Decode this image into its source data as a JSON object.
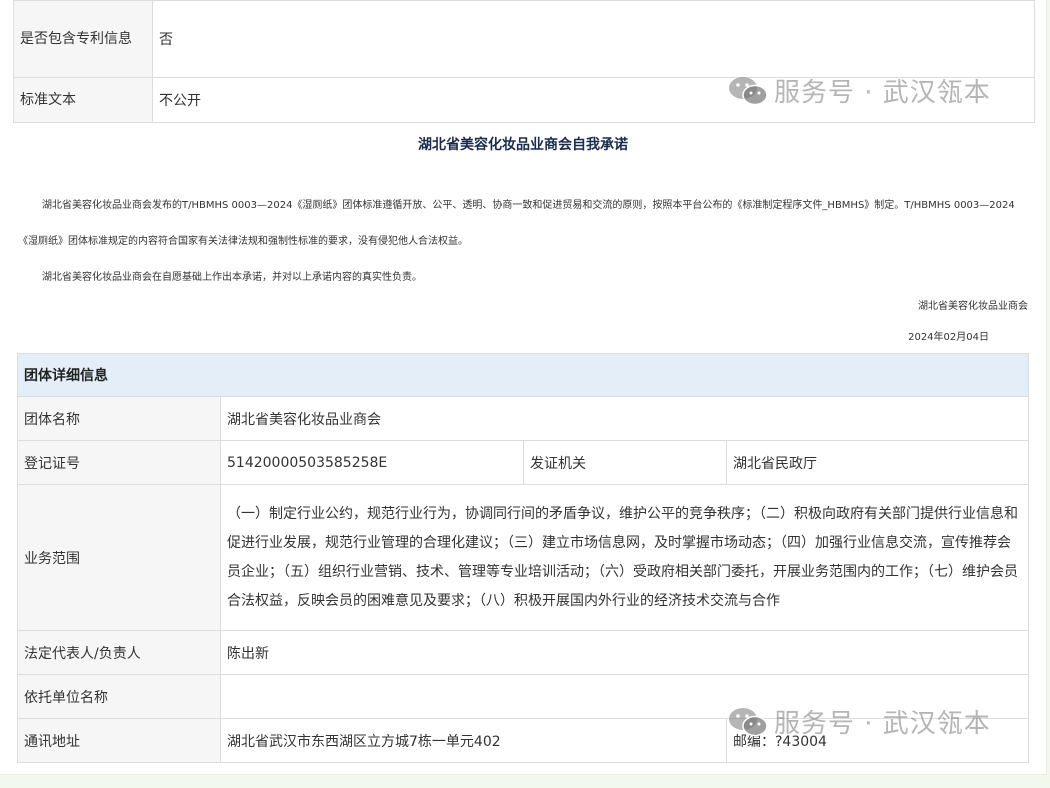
{
  "top_table": {
    "rows": [
      {
        "label": "是否包含专利信息",
        "value": "否"
      },
      {
        "label": "标准文本",
        "value": "不公开"
      }
    ]
  },
  "commitment": {
    "title": "湖北省美容化妆品业商会自我承诺",
    "paragraph1": "湖北省美容化妆品业商会发布的T/HBMHS 0003—2024《湿厕纸》团体标准遵循开放、公平、透明、协商一致和促进贸易和交流的原则，按照本平台公布的《标准制定程序文件_HBMHS》制定。T/HBMHS 0003—2024《湿厕纸》团体标准规定的内容符合国家有关法律法规和强制性标准的要求，没有侵犯他人合法权益。",
    "paragraph2": "湖北省美容化妆品业商会在自愿基础上作出本承诺，并对以上承诺内容的真实性负责。",
    "signature": "湖北省美容化妆品业商会",
    "date": "2024年02月04日"
  },
  "detail": {
    "header": "团体详细信息",
    "org_name_label": "团体名称",
    "org_name": "湖北省美容化妆品业商会",
    "reg_no_label": "登记证号",
    "reg_no": "51420000503585258E",
    "issuer_label": "发证机关",
    "issuer": "湖北省民政厅",
    "scope_label": "业务范围",
    "scope": "（一）制定行业公约，规范行业行为，协调同行间的矛盾争议，维护公平的竞争秩序；（二）积极向政府有关部门提供行业信息和促进行业发展，规范行业管理的合理化建议；（三）建立市场信息网，及时掌握市场动态；（四）加强行业信息交流，宣传推荐会员企业；（五）组织行业营销、技术、管理等专业培训活动；（六）受政府相关部门委托，开展业务范围内的工作；（七）维护会员合法权益，反映会员的困难意见及要求；（八）积极开展国内外行业的经济技术交流与合作",
    "rep_label": "法定代表人/负责人",
    "rep": "陈出新",
    "unit_label": "依托单位名称",
    "unit": "",
    "addr_label": "通讯地址",
    "addr": "湖北省武汉市东西湖区立方城7栋一单元402",
    "zip": "邮编：?43004"
  },
  "watermark": {
    "text": "服务号 · 武汉瓴本",
    "icon": "wechat-icon"
  }
}
